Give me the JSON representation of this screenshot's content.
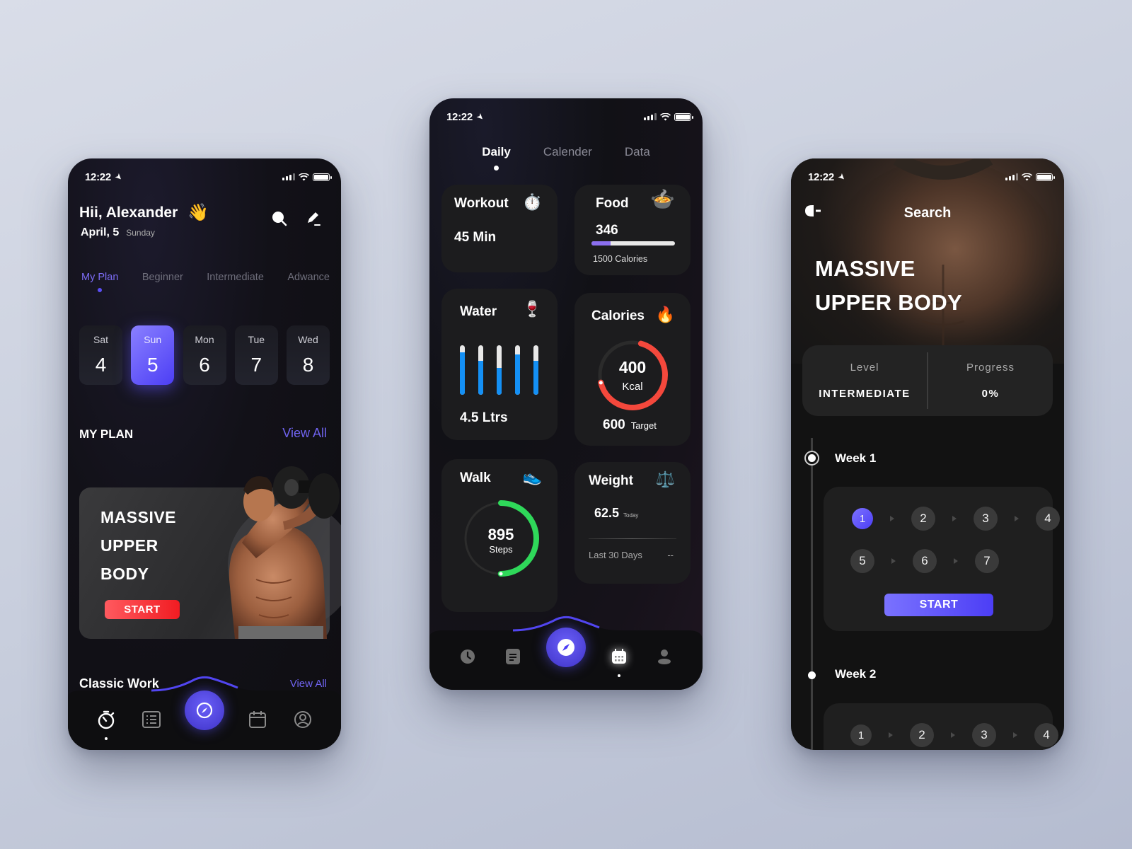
{
  "status_bar": {
    "time": "12:22"
  },
  "screen_home": {
    "greeting": "Hii, Alexander",
    "greeting_emoji": "👋",
    "date": "April, 5",
    "weekday": "Sunday",
    "tabs": [
      {
        "label": "My Plan",
        "active": true
      },
      {
        "label": "Beginner"
      },
      {
        "label": "Intermediate"
      },
      {
        "label": "Adwance"
      }
    ],
    "days": [
      {
        "name": "Sat",
        "num": "4"
      },
      {
        "name": "Sun",
        "num": "5",
        "selected": true
      },
      {
        "name": "Mon",
        "num": "6"
      },
      {
        "name": "Tue",
        "num": "7"
      },
      {
        "name": "Wed",
        "num": "8"
      }
    ],
    "section_title": "MY PLAN",
    "view_all": "View All",
    "plan_card": {
      "title_lines": [
        "MASSIVE",
        "UPPER",
        "BODY"
      ],
      "start_label": "START"
    },
    "classic_title": "Classic Work",
    "classic_view_all": "View All",
    "nav": [
      "timer-icon",
      "list-icon",
      "compass-icon",
      "calendar-icon",
      "profile-icon"
    ]
  },
  "screen_daily": {
    "tabs": [
      {
        "label": "Daily",
        "active": true
      },
      {
        "label": "Calender"
      },
      {
        "label": "Data"
      }
    ],
    "workout": {
      "title": "Workout",
      "icon": "⏱️",
      "value": "45 Min"
    },
    "food": {
      "title": "Food",
      "icon": "🍲",
      "value": "346",
      "goal_label": "1500 Calories",
      "progress": 0.23
    },
    "water": {
      "title": "Water",
      "icon": "🍷",
      "value": "4.5 Ltrs",
      "bar_levels": [
        0.86,
        0.69,
        0.54,
        0.82,
        0.69
      ]
    },
    "calories": {
      "title": "Calories",
      "icon": "🔥",
      "value": "400",
      "unit": "Kcal",
      "target": "600",
      "target_label": "Target",
      "progress": 0.67
    },
    "walk": {
      "title": "Walk",
      "icon": "👟",
      "value": "895",
      "unit": "Steps",
      "progress": 0.5
    },
    "weight": {
      "title": "Weight",
      "icon": "⚖️",
      "value": "62.5",
      "value_label": "Today",
      "period_label": "Last 30 Days",
      "period_value": "--"
    }
  },
  "screen_plan": {
    "header_title": "Search",
    "hero_title_lines": [
      "MASSIVE",
      "UPPER BODY"
    ],
    "level_label": "Level",
    "level_value": "INTERMEDIATE",
    "progress_label": "Progress",
    "progress_value": "0%",
    "weeks": [
      {
        "label": "Week 1",
        "rows": [
          [
            "1",
            "2",
            "3",
            "4"
          ],
          [
            "5",
            "6",
            "7"
          ]
        ],
        "current": "1",
        "start_label": "START"
      },
      {
        "label": "Week 2",
        "rows": [
          [
            "1",
            "2",
            "3",
            "4"
          ]
        ]
      }
    ]
  },
  "colors": {
    "accent": "#5b4ef5",
    "red": "#f4483c",
    "green": "#2fd85a",
    "water": "#1490f5"
  }
}
